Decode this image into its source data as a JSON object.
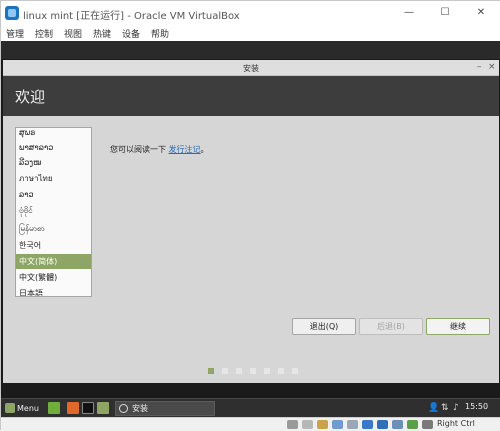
{
  "host": {
    "title": "linux mint [正在运行] - Oracle VM VirtualBox",
    "menu": [
      "管理",
      "控制",
      "视图",
      "热键",
      "设备",
      "帮助"
    ],
    "controls": {
      "minimize": "—",
      "maximize": "☐",
      "close": "✕"
    },
    "status": {
      "right_ctrl": "Right Ctrl"
    }
  },
  "installer": {
    "window_title": "安装",
    "window_controls": {
      "minimize": "–",
      "close": "×"
    },
    "heading": "欢迎",
    "languages": [
      "ສຸພຣ",
      "ພາສາລາວ",
      "ລີວງໝ",
      "ภาษาไทย",
      "ລາວ",
      "ဗုံဗိုင်",
      "မြန်မာစာ",
      "한국어",
      "中文(简体)",
      "中文(繁體)",
      "日本語"
    ],
    "selected_language": "中文(简体)",
    "notes_prefix": "您可以阅读一下",
    "notes_link": "发行注记",
    "notes_suffix": "。",
    "buttons": {
      "quit": "退出(Q)",
      "back": "后退(B)",
      "continue": "继续"
    },
    "progress_dots": 7,
    "progress_current": 1
  },
  "taskbar": {
    "menu_label": "Menu",
    "task_label": "安装",
    "clock": "15:50"
  },
  "colors": {
    "accent": "#8ea665",
    "header_bg": "#3d3d3d",
    "dialog_bg": "#d6d6d6",
    "link": "#2a6bb5"
  }
}
